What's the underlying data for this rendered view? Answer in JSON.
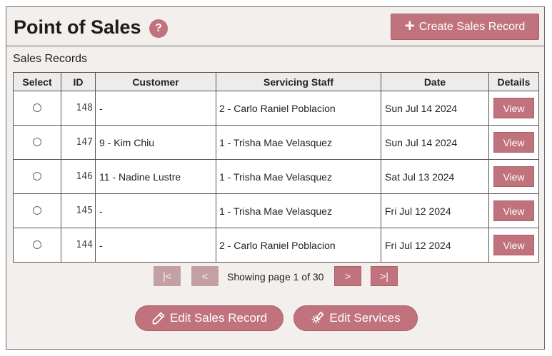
{
  "header": {
    "title": "Point of Sales",
    "help_label": "?",
    "create_label": "Create Sales Record"
  },
  "section_label": "Sales Records",
  "table": {
    "columns": [
      "Select",
      "ID",
      "Customer",
      "Servicing Staff",
      "Date",
      "Details"
    ],
    "rows": [
      {
        "id": "148",
        "customer": "-",
        "staff": "2 - Carlo Raniel Poblacion",
        "date": "Sun Jul 14 2024",
        "action": "View"
      },
      {
        "id": "147",
        "customer": "9 - Kim Chiu",
        "staff": "1 - Trisha Mae Velasquez",
        "date": "Sun Jul 14 2024",
        "action": "View"
      },
      {
        "id": "146",
        "customer": "11 - Nadine Lustre",
        "staff": "1 - Trisha Mae Velasquez",
        "date": "Sat Jul 13 2024",
        "action": "View"
      },
      {
        "id": "145",
        "customer": "-",
        "staff": "1 - Trisha Mae Velasquez",
        "date": "Fri Jul 12 2024",
        "action": "View"
      },
      {
        "id": "144",
        "customer": "-",
        "staff": "2 - Carlo Raniel Poblacion",
        "date": "Fri Jul 12 2024",
        "action": "View"
      }
    ]
  },
  "pagination": {
    "first": "|<",
    "prev": "<",
    "status": "Showing page 1 of 30",
    "next": ">",
    "last": ">|"
  },
  "actions": {
    "edit_sales": "Edit Sales Record",
    "edit_services": "Edit Services"
  },
  "colors": {
    "accent": "#c0727d",
    "accent_disabled": "#c3a0a4",
    "panel_bg": "#f3efec"
  },
  "icons": {
    "help": "question-icon",
    "create": "plus-icon",
    "edit_sales": "pencil-icon",
    "edit_services": "edit-settings-icon"
  }
}
